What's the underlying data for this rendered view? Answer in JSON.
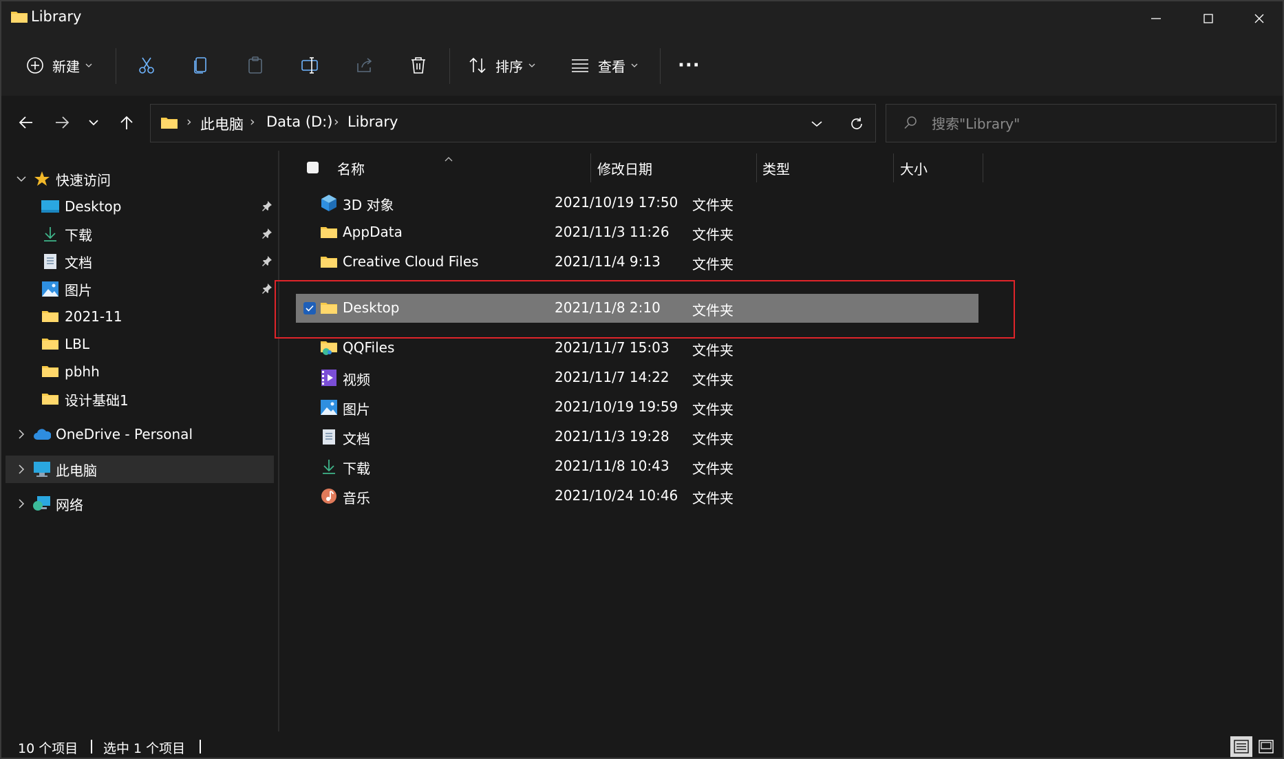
{
  "window": {
    "title": "Library",
    "controls": {
      "minimize": "minimize",
      "maximize": "maximize",
      "close": "close"
    }
  },
  "toolbar": {
    "new_label": "新建",
    "sort_label": "排序",
    "view_label": "查看",
    "more_label": "···",
    "icons": [
      "new-icon",
      "cut-icon",
      "copy-icon",
      "paste-icon",
      "rename-icon",
      "share-icon",
      "delete-icon",
      "sort-icon",
      "view-icon",
      "more-icon"
    ]
  },
  "address": {
    "crumbs": [
      "此电脑",
      "Data (D:)",
      "Library"
    ],
    "separator": "›"
  },
  "search": {
    "placeholder": "搜索\"Library\""
  },
  "sidebar": {
    "quick_access": "快速访问",
    "items": [
      {
        "label": "Desktop",
        "icon": "desktop-icon",
        "pinned": true
      },
      {
        "label": "下载",
        "icon": "download-icon",
        "pinned": true
      },
      {
        "label": "文档",
        "icon": "document-icon",
        "pinned": true
      },
      {
        "label": "图片",
        "icon": "pictures-icon",
        "pinned": true
      },
      {
        "label": "2021-11",
        "icon": "folder-icon",
        "pinned": false
      },
      {
        "label": "LBL",
        "icon": "folder-icon",
        "pinned": false
      },
      {
        "label": "pbhh",
        "icon": "folder-icon",
        "pinned": false
      },
      {
        "label": "设计基础1",
        "icon": "folder-icon",
        "pinned": false
      }
    ],
    "onedrive": "OneDrive - Personal",
    "this_pc": "此电脑",
    "network": "网络"
  },
  "columns": {
    "name": "名称",
    "modified": "修改日期",
    "type": "类型",
    "size": "大小"
  },
  "files": [
    {
      "name": "3D 对象",
      "date": "2021/10/19 17:50",
      "type": "文件夹",
      "icon": "3d-objects-icon"
    },
    {
      "name": "AppData",
      "date": "2021/11/3 11:26",
      "type": "文件夹",
      "icon": "folder-icon"
    },
    {
      "name": "Creative Cloud Files",
      "date": "2021/11/4 9:13",
      "type": "文件夹",
      "icon": "folder-icon"
    },
    {
      "name": "Desktop",
      "date": "2021/11/8 2:10",
      "type": "文件夹",
      "icon": "folder-icon",
      "selected": true
    },
    {
      "name": "QQFiles",
      "date": "2021/11/7 15:03",
      "type": "文件夹",
      "icon": "qq-folder-icon"
    },
    {
      "name": "视频",
      "date": "2021/11/7 14:22",
      "type": "文件夹",
      "icon": "videos-icon"
    },
    {
      "name": "图片",
      "date": "2021/10/19 19:59",
      "type": "文件夹",
      "icon": "pictures-icon"
    },
    {
      "name": "文档",
      "date": "2021/11/3 19:28",
      "type": "文件夹",
      "icon": "document-icon"
    },
    {
      "name": "下载",
      "date": "2021/11/8 10:43",
      "type": "文件夹",
      "icon": "download-icon"
    },
    {
      "name": "音乐",
      "date": "2021/10/24 10:46",
      "type": "文件夹",
      "icon": "music-icon"
    }
  ],
  "status": {
    "count": "10 个项目",
    "selected": "选中 1 个项目"
  },
  "colors": {
    "selection": "#777777",
    "highlight_border": "#e0242a",
    "checkbox": "#1e5fb8",
    "folder": "#f7c948"
  }
}
